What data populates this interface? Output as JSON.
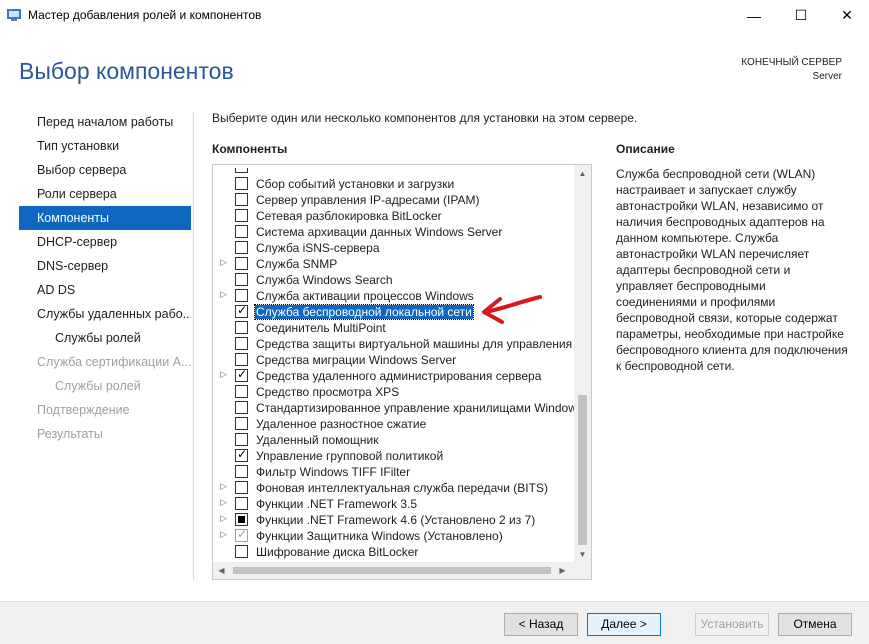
{
  "window": {
    "title": "Мастер добавления ролей и компонентов",
    "minimize": "—",
    "maximize": "☐",
    "close": "✕"
  },
  "header": {
    "page_title": "Выбор компонентов",
    "server_label": "КОНЕЧНЫЙ СЕРВЕР",
    "server_name": "Server"
  },
  "nav": {
    "items": [
      {
        "label": "Перед началом работы",
        "state": "normal"
      },
      {
        "label": "Тип установки",
        "state": "normal"
      },
      {
        "label": "Выбор сервера",
        "state": "normal"
      },
      {
        "label": "Роли сервера",
        "state": "normal"
      },
      {
        "label": "Компоненты",
        "state": "active"
      },
      {
        "label": "DHCP-сервер",
        "state": "normal"
      },
      {
        "label": "DNS-сервер",
        "state": "normal"
      },
      {
        "label": "AD DS",
        "state": "normal"
      },
      {
        "label": "Службы удаленных рабо...",
        "state": "normal"
      },
      {
        "label": "Службы ролей",
        "state": "normal"
      },
      {
        "label": "Служба сертификации А...",
        "state": "disabled"
      },
      {
        "label": "Службы ролей",
        "state": "disabled"
      },
      {
        "label": "Подтверждение",
        "state": "disabled"
      },
      {
        "label": "Результаты",
        "state": "disabled"
      }
    ]
  },
  "main": {
    "intro": "Выберите один или несколько компонентов для установки на этом сервере.",
    "components_header": "Компоненты",
    "description_header": "Описание",
    "description": "Служба беспроводной сети (WLAN) настраивает и запускает службу автонастройки WLAN, независимо от наличия беспроводных адаптеров на данном компьютере. Служба автонастройки WLAN перечисляет адаптеры беспроводной сети и управляет беспроводными соединениями и профилями беспроводной связи, которые содержат параметры, необходимые при настройке беспроводного клиента для подключения к беспроводной сети.",
    "components": [
      {
        "label": "Сбор событий установки и загрузки",
        "state": "unchecked",
        "expandable": false
      },
      {
        "label": "Сервер управления IP-адресами (IPAM)",
        "state": "unchecked",
        "expandable": false
      },
      {
        "label": "Сетевая разблокировка BitLocker",
        "state": "unchecked",
        "expandable": false
      },
      {
        "label": "Система архивации данных Windows Server",
        "state": "unchecked",
        "expandable": false
      },
      {
        "label": "Служба iSNS-сервера",
        "state": "unchecked",
        "expandable": false
      },
      {
        "label": "Служба SNMP",
        "state": "unchecked",
        "expandable": true
      },
      {
        "label": "Служба Windows Search",
        "state": "unchecked",
        "expandable": false
      },
      {
        "label": "Служба активации процессов Windows",
        "state": "unchecked",
        "expandable": true
      },
      {
        "label": "Служба беспроводной локальной сети",
        "state": "checked",
        "expandable": false,
        "selected": true
      },
      {
        "label": "Соединитель MultiPoint",
        "state": "unchecked",
        "expandable": false
      },
      {
        "label": "Средства защиты виртуальной машины для управления с",
        "state": "unchecked",
        "expandable": false
      },
      {
        "label": "Средства миграции Windows Server",
        "state": "unchecked",
        "expandable": false
      },
      {
        "label": "Средства удаленного администрирования сервера",
        "state": "checked",
        "expandable": true
      },
      {
        "label": "Средство просмотра XPS",
        "state": "unchecked",
        "expandable": false
      },
      {
        "label": "Стандартизированное управление хранилищами Window",
        "state": "unchecked",
        "expandable": false
      },
      {
        "label": "Удаленное разностное сжатие",
        "state": "unchecked",
        "expandable": false
      },
      {
        "label": "Удаленный помощник",
        "state": "unchecked",
        "expandable": false
      },
      {
        "label": "Управление групповой политикой",
        "state": "checked",
        "expandable": false
      },
      {
        "label": "Фильтр Windows TIFF IFilter",
        "state": "unchecked",
        "expandable": false
      },
      {
        "label": "Фоновая интеллектуальная служба передачи (BITS)",
        "state": "unchecked",
        "expandable": true
      },
      {
        "label": "Функции .NET Framework 3.5",
        "state": "unchecked",
        "expandable": true
      },
      {
        "label": "Функции .NET Framework 4.6 (Установлено 2 из 7)",
        "state": "partial",
        "expandable": true
      },
      {
        "label": "Функции Защитника Windows (Установлено)",
        "state": "grayed",
        "expandable": true
      },
      {
        "label": "Шифрование диска BitLocker",
        "state": "unchecked",
        "expandable": false
      }
    ]
  },
  "footer": {
    "back": "< Назад",
    "next": "Далее >",
    "install": "Установить",
    "cancel": "Отмена"
  },
  "colors": {
    "accent": "#0f67c1",
    "title": "#2b5797",
    "annotation_arrow": "#d7191f"
  }
}
